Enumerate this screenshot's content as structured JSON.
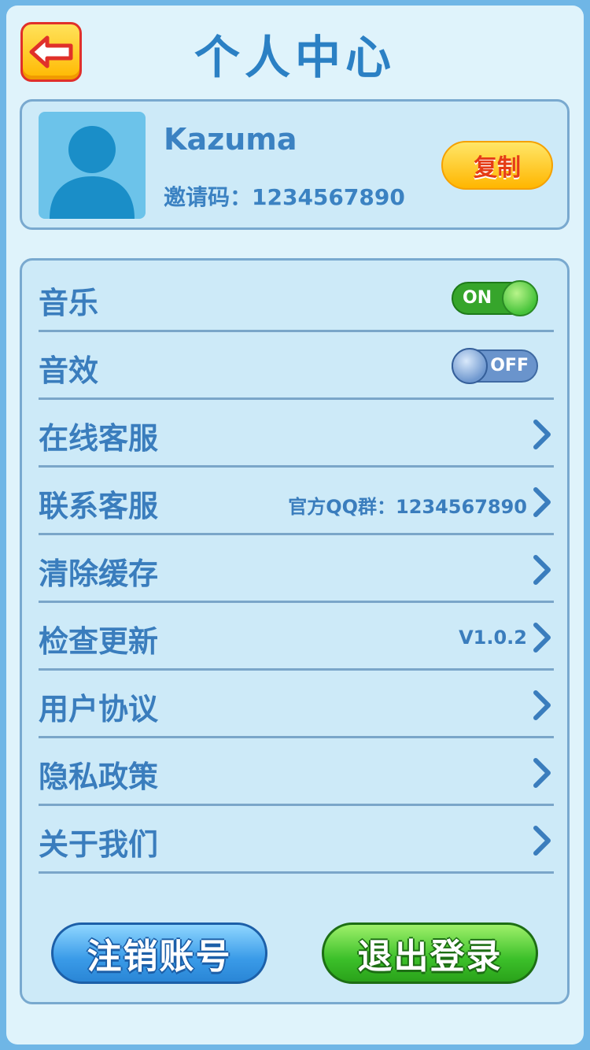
{
  "header": {
    "title": "个人中心",
    "back_icon": "arrow-left-icon"
  },
  "profile": {
    "username": "Kazuma",
    "invite_text": "邀请码：1234567890",
    "copy_label": "复制",
    "avatar_icon": "user-avatar-icon"
  },
  "settings": {
    "music": {
      "label": "音乐",
      "state": "ON"
    },
    "sound": {
      "label": "音效",
      "state": "OFF"
    },
    "items": [
      {
        "label": "在线客服",
        "value": ""
      },
      {
        "label": "联系客服",
        "value": "官方QQ群：1234567890"
      },
      {
        "label": "清除缓存",
        "value": ""
      },
      {
        "label": "检查更新",
        "value": "V1.0.2"
      },
      {
        "label": "用户协议",
        "value": ""
      },
      {
        "label": "隐私政策",
        "value": ""
      },
      {
        "label": "关于我们",
        "value": ""
      }
    ]
  },
  "actions": {
    "cancel_account": "注销账号",
    "logout": "退出登录"
  },
  "colors": {
    "title": "#2b80c4",
    "text": "#3a7dbd",
    "card_bg": "#cdeaf8",
    "accent_yellow": "#ffb600",
    "accent_green": "#3cc02a",
    "accent_blue": "#3a9be8"
  }
}
